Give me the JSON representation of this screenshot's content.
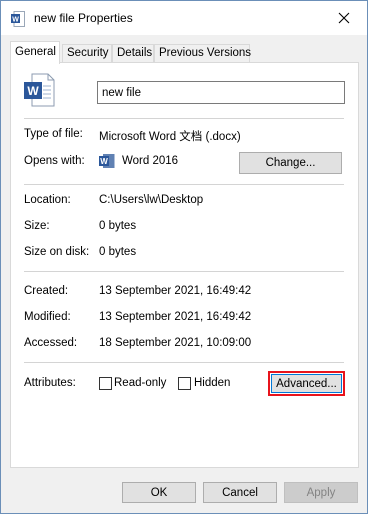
{
  "window": {
    "title": "new file Properties"
  },
  "tabs": [
    {
      "label": "General"
    },
    {
      "label": "Security"
    },
    {
      "label": "Details"
    },
    {
      "label": "Previous Versions"
    }
  ],
  "general": {
    "file_name": "new file",
    "type_of_file": {
      "label": "Type of file:",
      "value": "Microsoft Word 文档 (.docx)"
    },
    "opens_with": {
      "label": "Opens with:",
      "app": "Word 2016",
      "change_button": "Change..."
    },
    "location": {
      "label": "Location:",
      "value": "C:\\Users\\lw\\Desktop"
    },
    "size": {
      "label": "Size:",
      "value": "0 bytes"
    },
    "size_on_disk": {
      "label": "Size on disk:",
      "value": "0 bytes"
    },
    "created": {
      "label": "Created:",
      "value": "13 September 2021, 16:49:42"
    },
    "modified": {
      "label": "Modified:",
      "value": "13 September 2021, 16:49:42"
    },
    "accessed": {
      "label": "Accessed:",
      "value": "18 September 2021, 10:09:00"
    },
    "attributes": {
      "label": "Attributes:",
      "read_only": {
        "label": "Read-only",
        "checked": false
      },
      "hidden": {
        "label": "Hidden",
        "checked": false
      },
      "advanced_button": "Advanced..."
    }
  },
  "footer": {
    "ok": "OK",
    "cancel": "Cancel",
    "apply": "Apply"
  },
  "colors": {
    "word_blue": "#2b579a",
    "highlight": "#e8141c"
  }
}
